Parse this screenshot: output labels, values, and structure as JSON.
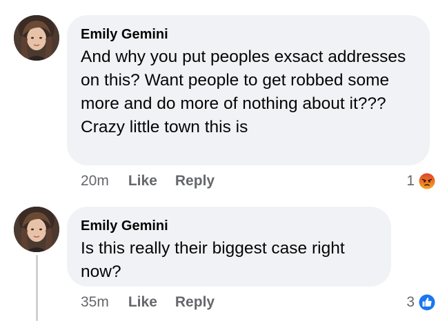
{
  "comments": [
    {
      "author": "Emily Gemini",
      "text": "And why you put peoples exsact addresses on this? Want people to get robbed some more and do more of nothing about it??? Crazy little town this is",
      "time": "20m",
      "like_label": "Like",
      "reply_label": "Reply",
      "reaction_count": "1",
      "reaction_icon": "angry-reaction-icon"
    },
    {
      "author": "Emily Gemini",
      "text": "Is this really their biggest case right now?",
      "time": "35m",
      "like_label": "Like",
      "reply_label": "Reply",
      "reaction_count": "3",
      "reaction_icon": "like-reaction-icon"
    }
  ],
  "colors": {
    "bubble": "#f0f2f5",
    "meta_text": "#65676b",
    "like_blue": "#1877f2",
    "angry_orange": "#f26b1d"
  }
}
